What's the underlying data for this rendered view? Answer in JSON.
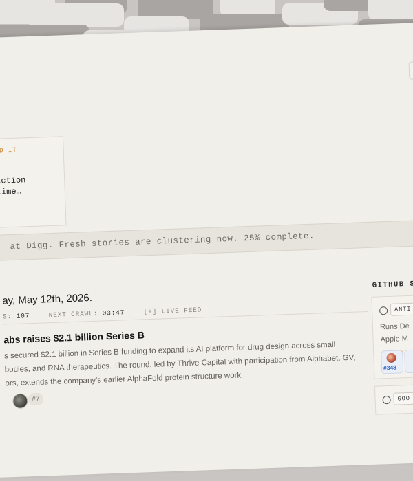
{
  "summary": {
    "kicker": "ED IT",
    "lines": [
      "s",
      "action",
      "time…"
    ]
  },
  "status": {
    "text": "at Digg. Fresh stories are clustering now. 25% complete.",
    "progress_percent": 25
  },
  "feed": {
    "date": "ay, May 12th, 2026.",
    "stories_label": "S:",
    "stories_count": "107",
    "next_crawl_label": "NEXT CRAWL:",
    "next_crawl_value": "03:47",
    "live_feed_label": "[+] LIVE FEED"
  },
  "story": {
    "title": "abs raises $2.1 billion Series B",
    "lines": [
      "s secured $2.1 billion in Series B funding to expand its AI platform for drug design across small",
      "bodies, and RNA therapeutics. The round, led by Thrive Capital with participation from Alphabet, GV,",
      "ors, extends the company's earlier AlphaFold protein structure work."
    ],
    "rank": "#7"
  },
  "github": {
    "heading": "GITHUB S",
    "cards": [
      {
        "tag": "ANTI",
        "desc_lines": [
          "Runs De",
          "Apple M"
        ],
        "pr_number": "#348",
        "icon": "github-icon"
      },
      {
        "tag": "GOO",
        "icon": "github-icon"
      }
    ]
  },
  "colors": {
    "background": "#f1efe9",
    "accent": "#c9781f",
    "link_blue": "#2f63c2"
  }
}
